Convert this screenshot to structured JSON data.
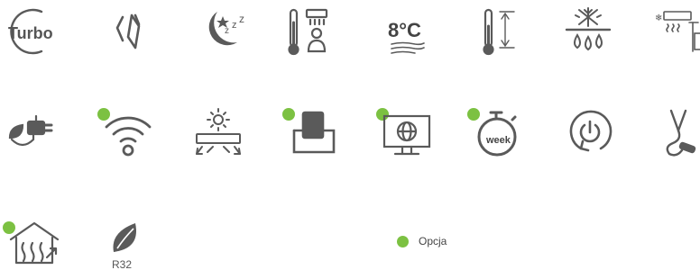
{
  "icons": {
    "turbo": {
      "label": "Turbo"
    },
    "temp8": {
      "label": "8°C"
    },
    "r32": {
      "label": "R32"
    },
    "timer": {
      "label": "week"
    }
  },
  "legend": {
    "label": "Opcja"
  },
  "colors": {
    "icon": "#5a5a5a",
    "option_dot": "#7cc142"
  }
}
